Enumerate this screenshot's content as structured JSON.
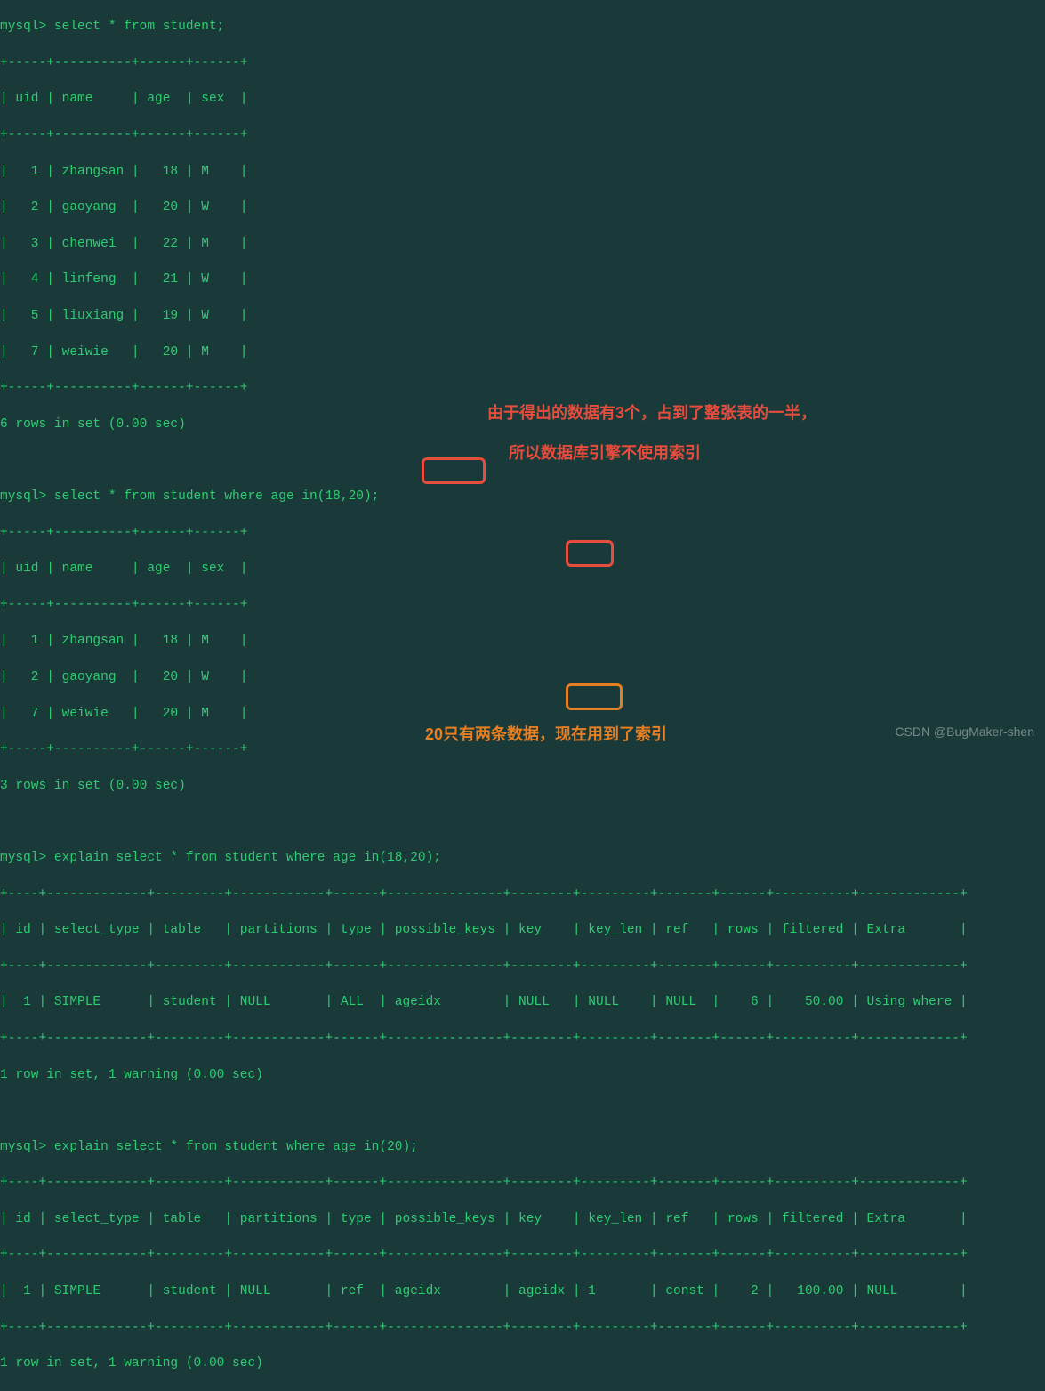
{
  "prompts": {
    "p1": "mysql> select * from student;",
    "p2": "mysql> select * from student where age in(18,20);",
    "p3": "mysql> explain select * from student where age in(18,20);",
    "p4": "mysql> explain select * from student where age in(20);"
  },
  "headers_small": "| uid | name     | age  | sex  |",
  "sep_small": "+-----+----------+------+------+",
  "rows1": [
    "|   1 | zhangsan |   18 | M    |",
    "|   2 | gaoyang  |   20 | W    |",
    "|   3 | chenwei  |   22 | M    |",
    "|   4 | linfeng  |   21 | W    |",
    "|   5 | liuxiang |   19 | W    |",
    "|   7 | weiwie   |   20 | M    |"
  ],
  "result1": "6 rows in set (0.00 sec)",
  "rows2": [
    "|   1 | zhangsan |   18 | M    |",
    "|   2 | gaoyang  |   20 | W    |",
    "|   7 | weiwie   |   20 | M    |"
  ],
  "result2": "3 rows in set (0.00 sec)",
  "sep_big": "+----+-------------+---------+------------+------+---------------+--------+---------+-------+------+----------+-------------+",
  "head_big": "| id | select_type | table   | partitions | type | possible_keys | key    | key_len | ref   | rows | filtered | Extra       |",
  "row_big1": "|  1 | SIMPLE      | student | NULL       | ALL  | ageidx        | NULL   | NULL    | NULL  |    6 |    50.00 | Using where |",
  "row_big2": "|  1 | SIMPLE      | student | NULL       | ref  | ageidx        | ageidx | 1       | const |    2 |   100.00 | NULL        |",
  "result3": "1 row in set, 1 warning (0.00 sec)",
  "result4": "1 row in set, 1 warning (0.00 sec)",
  "annotations": {
    "red1": "由于得出的数据有3个，占到了整张表的一半，",
    "red2": "所以数据库引擎不使用索引",
    "orange": "20只有两条数据，现在用到了索引"
  },
  "watermark": "CSDN @BugMaker-shen",
  "chart_data": {
    "type": "table",
    "tables": [
      {
        "name": "student_full",
        "columns": [
          "uid",
          "name",
          "age",
          "sex"
        ],
        "rows": [
          [
            1,
            "zhangsan",
            18,
            "M"
          ],
          [
            2,
            "gaoyang",
            20,
            "W"
          ],
          [
            3,
            "chenwei",
            22,
            "M"
          ],
          [
            4,
            "linfeng",
            21,
            "W"
          ],
          [
            5,
            "liuxiang",
            19,
            "W"
          ],
          [
            7,
            "weiwie",
            20,
            "M"
          ]
        ]
      },
      {
        "name": "student_filtered_18_20",
        "columns": [
          "uid",
          "name",
          "age",
          "sex"
        ],
        "rows": [
          [
            1,
            "zhangsan",
            18,
            "M"
          ],
          [
            2,
            "gaoyang",
            20,
            "W"
          ],
          [
            7,
            "weiwie",
            20,
            "M"
          ]
        ]
      },
      {
        "name": "explain_in_18_20",
        "columns": [
          "id",
          "select_type",
          "table",
          "partitions",
          "type",
          "possible_keys",
          "key",
          "key_len",
          "ref",
          "rows",
          "filtered",
          "Extra"
        ],
        "rows": [
          [
            1,
            "SIMPLE",
            "student",
            "NULL",
            "ALL",
            "ageidx",
            "NULL",
            "NULL",
            "NULL",
            6,
            50.0,
            "Using where"
          ]
        ]
      },
      {
        "name": "explain_in_20",
        "columns": [
          "id",
          "select_type",
          "table",
          "partitions",
          "type",
          "possible_keys",
          "key",
          "key_len",
          "ref",
          "rows",
          "filtered",
          "Extra"
        ],
        "rows": [
          [
            1,
            "SIMPLE",
            "student",
            "NULL",
            "ref",
            "ageidx",
            "ageidx",
            1,
            "const",
            2,
            100.0,
            "NULL"
          ]
        ]
      }
    ]
  }
}
